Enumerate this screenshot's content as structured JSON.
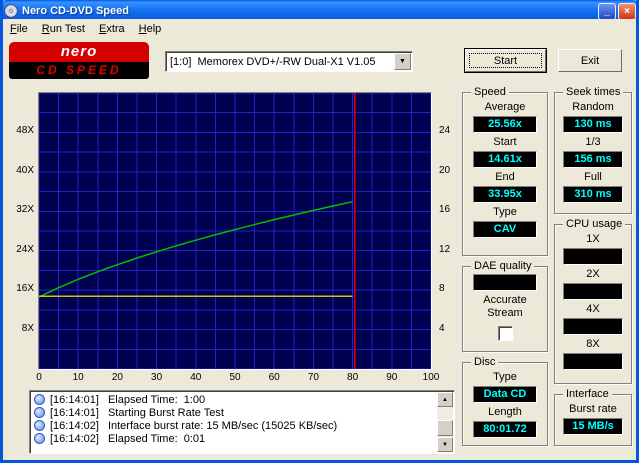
{
  "titlebar": {
    "title": "Nero CD-DVD Speed"
  },
  "icons": {
    "minimize": "_",
    "close": "×",
    "dropdown": "▼",
    "scroll_up": "▲",
    "scroll_down": "▼"
  },
  "menu": {
    "items": [
      {
        "accel": "F",
        "rest": "ile"
      },
      {
        "accel": "R",
        "rest": "un Test"
      },
      {
        "accel": "E",
        "rest": "xtra"
      },
      {
        "accel": "H",
        "rest": "elp"
      }
    ]
  },
  "toolbar": {
    "logo_line1": "nero",
    "logo_line2": "CD SPEED",
    "drive_select": "[1:0]  Memorex DVD+/-RW Dual-X1 V1.05",
    "start_label": "Start",
    "exit_label": "Exit"
  },
  "panels": {
    "speed": {
      "title": "Speed",
      "fields": [
        {
          "label": "Average",
          "value": "25.56x"
        },
        {
          "label": "Start",
          "value": "14.61x"
        },
        {
          "label": "End",
          "value": "33.95x"
        },
        {
          "label": "Type",
          "value": "CAV"
        }
      ]
    },
    "seek_times": {
      "title": "Seek times",
      "fields": [
        {
          "label": "Random",
          "value": "130 ms"
        },
        {
          "label": "1/3",
          "value": "156 ms"
        },
        {
          "label": "Full",
          "value": "310 ms"
        }
      ]
    },
    "cpu_usage": {
      "title": "CPU usage",
      "fields": [
        {
          "label": "1X",
          "value": ""
        },
        {
          "label": "2X",
          "value": ""
        },
        {
          "label": "4X",
          "value": ""
        },
        {
          "label": "8X",
          "value": ""
        }
      ]
    },
    "dae_quality": {
      "title": "DAE quality",
      "value": "",
      "checkbox_label": "Accurate Stream",
      "checkbox_checked": false
    },
    "disc": {
      "title": "Disc",
      "fields": [
        {
          "label": "Type",
          "value": "Data CD"
        },
        {
          "label": "Length",
          "value": "80:01.72"
        }
      ]
    },
    "interface": {
      "title": "Interface",
      "fields": [
        {
          "label": "Burst rate",
          "value": "15 MB/s"
        }
      ]
    }
  },
  "log": {
    "entries": [
      {
        "time": "[16:14:01]",
        "text": "Elapsed Time:  1:00"
      },
      {
        "time": "[16:14:01]",
        "text": "Starting Burst Rate Test"
      },
      {
        "time": "[16:14:02]",
        "text": "Interface burst rate: 15 MB/sec (15025 KB/sec)"
      },
      {
        "time": "[16:14:02]",
        "text": "Elapsed Time:  0:01"
      }
    ]
  },
  "colors": {
    "value_text": "#00ffff"
  },
  "chart_data": {
    "type": "line",
    "title": "",
    "xlabel": "",
    "ylabel": "",
    "xlim": [
      0,
      100
    ],
    "ylim": [
      0,
      56
    ],
    "bg_color": "#000050",
    "grid": {
      "x_step": 5,
      "y_step": 4,
      "color": "#2222cc"
    },
    "x_ticks": [
      0,
      10,
      20,
      30,
      40,
      50,
      60,
      70,
      80,
      90,
      100
    ],
    "y_ticks_left": [
      {
        "value": 48,
        "label": "48X"
      },
      {
        "value": 40,
        "label": "40X"
      },
      {
        "value": 32,
        "label": "32X"
      },
      {
        "value": 24,
        "label": "24X"
      },
      {
        "value": 16,
        "label": "16X"
      },
      {
        "value": 8,
        "label": "8X"
      }
    ],
    "y_ticks_right": [
      {
        "value": 48,
        "label": "24"
      },
      {
        "value": 40,
        "label": "20"
      },
      {
        "value": 32,
        "label": "16"
      },
      {
        "value": 24,
        "label": "12"
      },
      {
        "value": 16,
        "label": "8"
      },
      {
        "value": 8,
        "label": "4"
      }
    ],
    "series": [
      {
        "name": "read-speed-curve",
        "color": "#00c000",
        "x": [
          0,
          5,
          10,
          15,
          20,
          25,
          30,
          35,
          40,
          45,
          50,
          55,
          60,
          65,
          70,
          75,
          80
        ],
        "y": [
          14.61,
          16.5,
          18.19,
          19.74,
          21.17,
          22.52,
          23.78,
          24.99,
          26.14,
          27.24,
          28.29,
          29.31,
          30.3,
          31.25,
          32.18,
          33.08,
          33.95
        ]
      },
      {
        "name": "baseline-speed-line",
        "color": "#c8c800",
        "x_start": 0,
        "x_end": 80,
        "y_value": 14.8
      },
      {
        "name": "end-of-disc-marker",
        "color": "#e00000",
        "x_value": 80.5
      }
    ]
  }
}
